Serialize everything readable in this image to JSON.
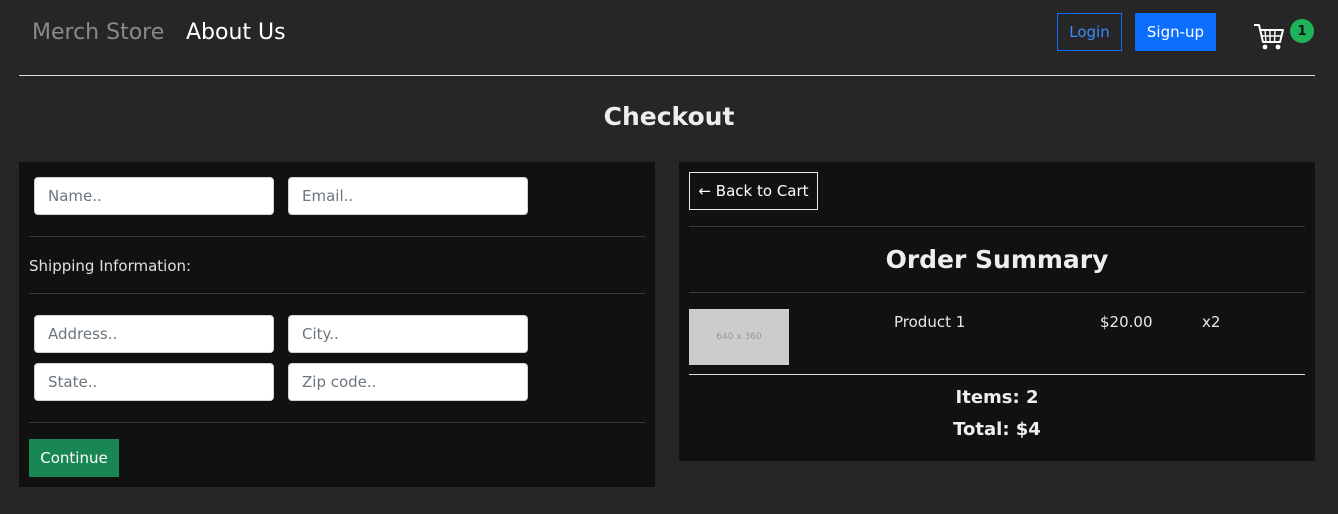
{
  "nav": {
    "brand": "Merch Store",
    "about_link": "About Us",
    "login_label": "Login",
    "signup_label": "Sign-up",
    "cart_count": "1"
  },
  "page_title": "Checkout",
  "form": {
    "name_placeholder": "Name..",
    "email_placeholder": "Email..",
    "shipping_label": "Shipping Information:",
    "address_placeholder": "Address..",
    "city_placeholder": "City..",
    "state_placeholder": "State..",
    "zip_placeholder": "Zip code..",
    "continue_label": "Continue"
  },
  "summary": {
    "back_label": "← Back to Cart",
    "title": "Order Summary",
    "items": [
      {
        "image_placeholder": "640 x 360",
        "name": "Product 1",
        "price": "$20.00",
        "quantity": "x2"
      }
    ],
    "items_text": "Items: 2",
    "total_text": "Total: $4"
  },
  "colors": {
    "background": "#262626",
    "panel": "#111111",
    "primary": "#0d6efd",
    "success": "#198754",
    "badge": "#1eb35a"
  }
}
